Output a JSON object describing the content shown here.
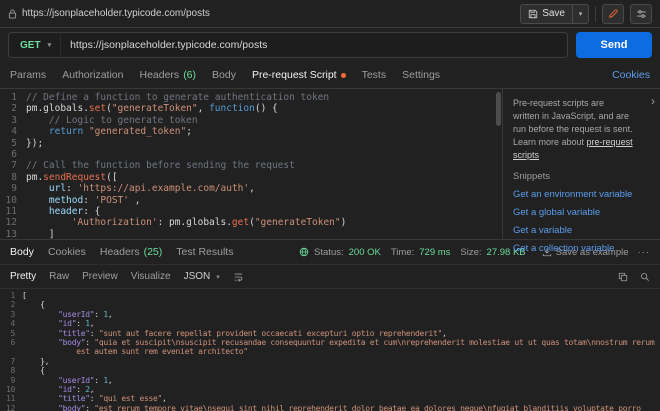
{
  "colors": {
    "accent_orange": "#ff6c37",
    "method_green": "#6bdd9a",
    "send_blue": "#0d6ce0",
    "link_blue": "#5c9ded",
    "status_green": "#6bdd9a",
    "background": "#212121"
  },
  "topbar": {
    "url": "https://jsonplaceholder.typicode.com/posts",
    "save_label": "Save"
  },
  "request": {
    "method": "GET",
    "url": "https://jsonplaceholder.typicode.com/posts",
    "send_label": "Send"
  },
  "request_tabs": {
    "items": [
      {
        "label": "Params"
      },
      {
        "label": "Authorization"
      },
      {
        "label": "Headers",
        "count": "(6)"
      },
      {
        "label": "Body"
      },
      {
        "label": "Pre-request Script",
        "active": true,
        "dot": true
      },
      {
        "label": "Tests"
      },
      {
        "label": "Settings"
      }
    ],
    "cookies_link": "Cookies"
  },
  "script_editor": {
    "lines": [
      {
        "n": "1",
        "tk": [
          [
            "cm",
            "// Define a function to generate authentication token"
          ]
        ]
      },
      {
        "n": "2",
        "tk": [
          [
            "pl",
            "pm.globals."
          ],
          [
            "fn",
            "set"
          ],
          [
            "pl",
            "("
          ],
          [
            "st",
            "\"generateToken\""
          ],
          [
            "pl",
            ", "
          ],
          [
            "kw",
            "function"
          ],
          [
            "pl",
            "() {"
          ]
        ]
      },
      {
        "n": "3",
        "tk": [
          [
            "cm",
            "    // Logic to generate token"
          ]
        ]
      },
      {
        "n": "4",
        "tk": [
          [
            "pl",
            "    "
          ],
          [
            "kw",
            "return"
          ],
          [
            "pl",
            " "
          ],
          [
            "st",
            "\"generated_token\""
          ],
          [
            "pl",
            ";"
          ]
        ]
      },
      {
        "n": "5",
        "tk": [
          [
            "pl",
            "});"
          ]
        ]
      },
      {
        "n": "6",
        "tk": []
      },
      {
        "n": "7",
        "tk": [
          [
            "cm",
            "// Call the function before sending the request"
          ]
        ]
      },
      {
        "n": "8",
        "tk": [
          [
            "pl",
            "pm."
          ],
          [
            "fn",
            "sendRequest"
          ],
          [
            "pl",
            "(["
          ]
        ]
      },
      {
        "n": "9",
        "tk": [
          [
            "pl",
            "    "
          ],
          [
            "ky",
            "url"
          ],
          [
            "pl",
            ": "
          ],
          [
            "st",
            "'https://api.example.com/auth'"
          ],
          [
            "pl",
            ","
          ]
        ]
      },
      {
        "n": "10",
        "tk": [
          [
            "pl",
            "    "
          ],
          [
            "ky",
            "method"
          ],
          [
            "pl",
            ": "
          ],
          [
            "st",
            "'POST'"
          ],
          [
            "pl",
            " ,"
          ]
        ]
      },
      {
        "n": "11",
        "tk": [
          [
            "pl",
            "    "
          ],
          [
            "ky",
            "header"
          ],
          [
            "pl",
            ": {"
          ]
        ]
      },
      {
        "n": "12",
        "tk": [
          [
            "pl",
            "        "
          ],
          [
            "st",
            "'Authorization'"
          ],
          [
            "pl",
            ": pm.globals."
          ],
          [
            "fn",
            "get"
          ],
          [
            "pl",
            "("
          ],
          [
            "st",
            "\"generateToken\""
          ],
          [
            "pl",
            ")"
          ]
        ]
      },
      {
        "n": "13",
        "tk": [
          [
            "pl",
            "    ]"
          ]
        ]
      }
    ]
  },
  "snippets_panel": {
    "description": "Pre-request scripts are written in JavaScript, and are run before the request is sent. Learn more about ",
    "link": "pre-request scripts",
    "title": "Snippets",
    "items": [
      "Get an environment variable",
      "Get a global variable",
      "Get a variable",
      "Get a collection variable"
    ]
  },
  "response": {
    "tabs": [
      {
        "label": "Body",
        "active": true
      },
      {
        "label": "Cookies"
      },
      {
        "label": "Headers",
        "count": "(25)"
      },
      {
        "label": "Test Results"
      }
    ],
    "meta": {
      "status_label": "Status:",
      "status_value": "200 OK",
      "time_label": "Time:",
      "time_value": "729 ms",
      "size_label": "Size:",
      "size_value": "27.98 KB",
      "save_example": "Save as example",
      "more": "···"
    },
    "view_tabs": [
      {
        "label": "Pretty",
        "active": true
      },
      {
        "label": "Raw"
      },
      {
        "label": "Preview"
      },
      {
        "label": "Visualize"
      }
    ],
    "format": "JSON",
    "body_lines": [
      {
        "n": "1",
        "tk": [
          [
            "pl",
            "["
          ]
        ]
      },
      {
        "n": "2",
        "tk": [
          [
            "pl",
            "    {"
          ]
        ]
      },
      {
        "n": "3",
        "tk": [
          [
            "pl",
            "        "
          ],
          [
            "rk",
            "\"userId\""
          ],
          [
            "pl",
            ": "
          ],
          [
            "nm",
            "1"
          ],
          [
            "pl",
            ","
          ]
        ]
      },
      {
        "n": "4",
        "tk": [
          [
            "pl",
            "        "
          ],
          [
            "rk",
            "\"id\""
          ],
          [
            "pl",
            ": "
          ],
          [
            "nm",
            "1"
          ],
          [
            "pl",
            ","
          ]
        ]
      },
      {
        "n": "5",
        "tk": [
          [
            "pl",
            "        "
          ],
          [
            "rk",
            "\"title\""
          ],
          [
            "pl",
            ": "
          ],
          [
            "st",
            "\"sunt aut facere repellat provident occaecati excepturi optio reprehenderit\""
          ],
          [
            "pl",
            ","
          ]
        ]
      },
      {
        "n": "6",
        "tk": [
          [
            "pl",
            "        "
          ],
          [
            "rk",
            "\"body\""
          ],
          [
            "pl",
            ": "
          ],
          [
            "st",
            "\"quia et suscipit\\nsuscipit recusandae consequuntur expedita et cum\\nreprehenderit molestiae ut ut quas totam\\nnostrum rerum"
          ]
        ]
      },
      {
        "n": "",
        "tk": [
          [
            "st",
            "            est autem sunt rem eveniet architecto\""
          ]
        ]
      },
      {
        "n": "7",
        "tk": [
          [
            "pl",
            "    },"
          ]
        ]
      },
      {
        "n": "8",
        "tk": [
          [
            "pl",
            "    {"
          ]
        ]
      },
      {
        "n": "9",
        "tk": [
          [
            "pl",
            "        "
          ],
          [
            "rk",
            "\"userId\""
          ],
          [
            "pl",
            ": "
          ],
          [
            "nm",
            "1"
          ],
          [
            "pl",
            ","
          ]
        ]
      },
      {
        "n": "10",
        "tk": [
          [
            "pl",
            "        "
          ],
          [
            "rk",
            "\"id\""
          ],
          [
            "pl",
            ": "
          ],
          [
            "nm",
            "2"
          ],
          [
            "pl",
            ","
          ]
        ]
      },
      {
        "n": "11",
        "tk": [
          [
            "pl",
            "        "
          ],
          [
            "rk",
            "\"title\""
          ],
          [
            "pl",
            ": "
          ],
          [
            "st",
            "\"qui est esse\""
          ],
          [
            "pl",
            ","
          ]
        ]
      },
      {
        "n": "12",
        "tk": [
          [
            "pl",
            "        "
          ],
          [
            "rk",
            "\"body\""
          ],
          [
            "pl",
            ": "
          ],
          [
            "st",
            "\"est rerum tempore vitae\\nsequi sint nihil reprehenderit dolor beatae ea dolores neque\\nfugiat blanditiis voluptate porro"
          ]
        ]
      }
    ]
  }
}
